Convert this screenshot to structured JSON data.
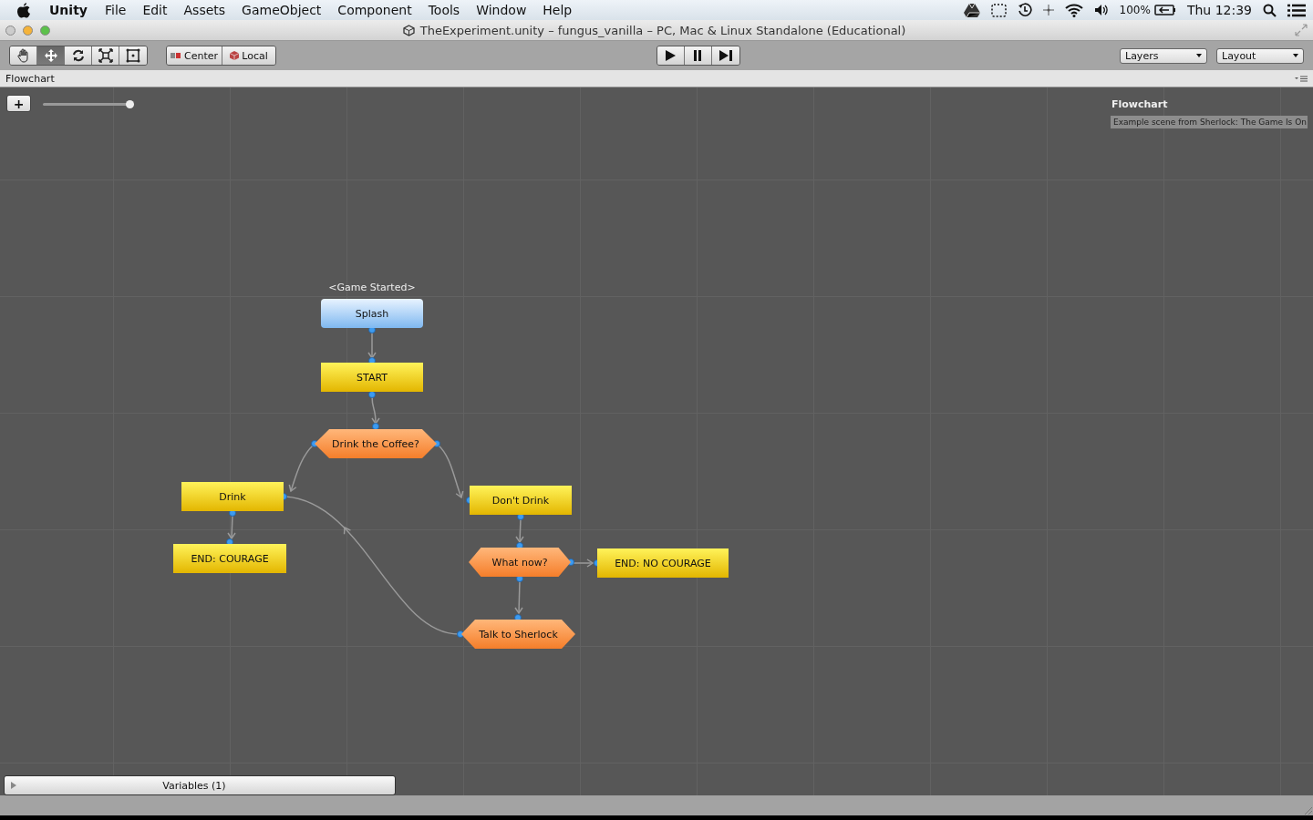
{
  "menu_bar": {
    "app": "Unity",
    "items": [
      "File",
      "Edit",
      "Assets",
      "GameObject",
      "Component",
      "Tools",
      "Window",
      "Help"
    ],
    "battery": "100%",
    "clock": "Thu 12:39"
  },
  "window": {
    "title": "TheExperiment.unity – fungus_vanilla – PC, Mac & Linux Standalone (Educational)"
  },
  "toolbar": {
    "tools": [
      {
        "kind": "hand",
        "selected": false
      },
      {
        "kind": "move",
        "selected": true
      },
      {
        "kind": "rotate",
        "selected": false
      },
      {
        "kind": "scale",
        "selected": false
      },
      {
        "kind": "rect",
        "selected": false
      }
    ],
    "pivot": [
      {
        "kind": "center",
        "label": "Center"
      },
      {
        "kind": "local",
        "label": "Local"
      }
    ],
    "playback": [
      {
        "kind": "play"
      },
      {
        "kind": "pause"
      },
      {
        "kind": "step"
      }
    ],
    "dropdowns": [
      "Layers",
      "Layout"
    ]
  },
  "tab": {
    "title": "Flowchart"
  },
  "zoom": {
    "button": "+",
    "level": 1.0
  },
  "info": {
    "title": "Flowchart",
    "description": "Example scene from Sherlock: The Game Is On"
  },
  "nodes": [
    {
      "kind": "event",
      "label": "Splash",
      "event": "<Game Started>"
    },
    {
      "kind": "block",
      "label": "START"
    },
    {
      "kind": "choice",
      "label": "Drink the Coffee?"
    },
    {
      "kind": "block",
      "label": "Drink"
    },
    {
      "kind": "block",
      "label": "Don't Drink"
    },
    {
      "kind": "block",
      "label": "END: COURAGE"
    },
    {
      "kind": "choice",
      "label": "What now?"
    },
    {
      "kind": "block",
      "label": "END: NO COURAGE"
    },
    {
      "kind": "choice",
      "label": "Talk to Sherlock"
    }
  ],
  "variables": {
    "label": "Variables (1)",
    "expanded": false
  }
}
